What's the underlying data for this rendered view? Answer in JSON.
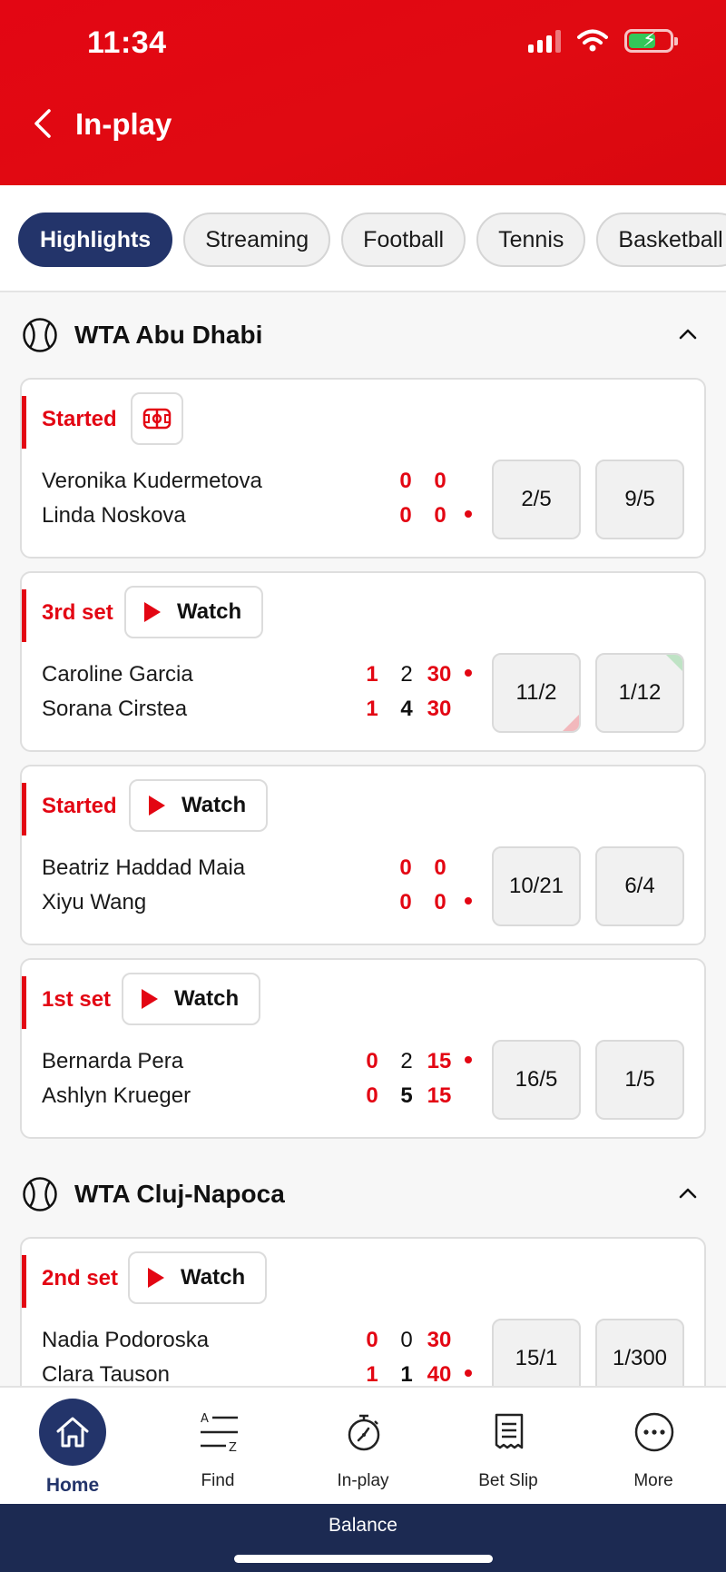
{
  "status_bar": {
    "time": "11:34"
  },
  "header": {
    "title": "In-play"
  },
  "tabs": [
    {
      "label": "Highlights",
      "active": true
    },
    {
      "label": "Streaming",
      "active": false
    },
    {
      "label": "Football",
      "active": false
    },
    {
      "label": "Tennis",
      "active": false
    },
    {
      "label": "Basketball",
      "active": false
    }
  ],
  "sections": [
    {
      "title": "WTA Abu Dhabi",
      "events": [
        {
          "state": "Started",
          "watch_label": "",
          "p1": "Veronika Kudermetova",
          "p2": "Linda Noskova",
          "sets1": "0",
          "sets2": "0",
          "games1": "0",
          "games2": "0",
          "odds1": "2/5",
          "odds2": "9/5"
        },
        {
          "state": "3rd set",
          "watch_label": "Watch",
          "p1": "Caroline Garcia",
          "p2": "Sorana Cirstea",
          "sets1": "1",
          "sets2": "1",
          "games1": "2",
          "games2": "4",
          "pts1": "30",
          "pts2": "30",
          "odds1": "11/2",
          "odds2": "1/12"
        },
        {
          "state": "Started",
          "watch_label": "Watch",
          "p1": "Beatriz Haddad Maia",
          "p2": "Xiyu Wang",
          "sets1": "0",
          "sets2": "0",
          "games1": "0",
          "games2": "0",
          "odds1": "10/21",
          "odds2": "6/4"
        },
        {
          "state": "1st set",
          "watch_label": "Watch",
          "p1": "Bernarda Pera",
          "p2": "Ashlyn Krueger",
          "sets1": "0",
          "sets2": "0",
          "games1": "2",
          "games2": "5",
          "pts1": "15",
          "pts2": "15",
          "odds1": "16/5",
          "odds2": "1/5"
        }
      ]
    },
    {
      "title": "WTA Cluj-Napoca",
      "events": [
        {
          "state": "2nd set",
          "watch_label": "Watch",
          "p1": "Nadia Podoroska",
          "p2": "Clara Tauson",
          "sets1": "0",
          "sets2": "1",
          "games1": "0",
          "games2": "1",
          "pts1": "30",
          "pts2": "40",
          "odds1": "15/1",
          "odds2": "1/300"
        }
      ]
    }
  ],
  "bottom_nav": [
    {
      "label": "Home",
      "icon": "home-icon",
      "active": true
    },
    {
      "label": "Find",
      "icon": "a-z-icon",
      "active": false
    },
    {
      "label": "In-play",
      "icon": "stopwatch-icon",
      "active": false
    },
    {
      "label": "Bet Slip",
      "icon": "receipt-icon",
      "active": false
    },
    {
      "label": "More",
      "icon": "more-icon",
      "active": false
    }
  ],
  "balance": {
    "label": "Balance"
  },
  "colors": {
    "brand_red": "#e30613",
    "navy": "#23346a",
    "balance_bar": "#1c2a52"
  }
}
